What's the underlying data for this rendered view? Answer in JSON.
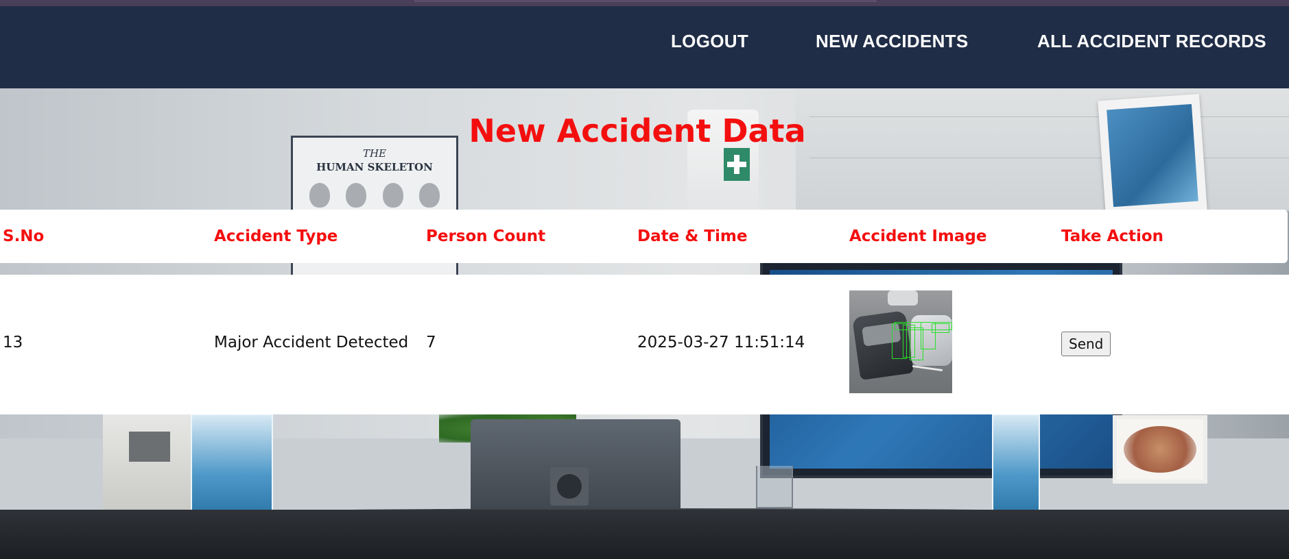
{
  "navbar": {
    "links": [
      {
        "label": "LOGOUT"
      },
      {
        "label": "NEW ACCIDENTS"
      },
      {
        "label": "ALL ACCIDENT RECORDS"
      }
    ]
  },
  "page": {
    "title": "New Accident Data"
  },
  "background": {
    "poster_line1": "THE",
    "poster_line2": "HUMAN SKELETON"
  },
  "table": {
    "headers": [
      "S.No",
      "Accident Type",
      "Person Count",
      "Date & Time",
      "Accident Image",
      "Take Action"
    ],
    "rows": [
      {
        "sno": "13",
        "type": "Major Accident Detected",
        "person_count": "7",
        "datetime": "2025-03-27 11:51:14",
        "image_icon": "accident-photo-thumbnail",
        "action_label": "Send"
      }
    ]
  },
  "colors": {
    "navbar": "#202d47",
    "accent_red": "#f40f0f",
    "detection_box": "#27e02a"
  }
}
